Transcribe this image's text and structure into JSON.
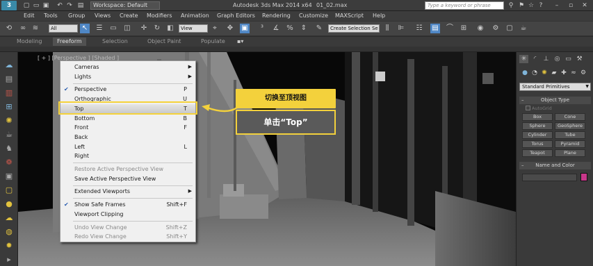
{
  "app": {
    "logo_label": "3",
    "title": "Autodesk 3ds Max  2014 x64",
    "file_name": "01_02.max",
    "workspace": "Workspace: Default",
    "search_placeholder": "Type a keyword or phrase"
  },
  "menubar": {
    "items": [
      "Edit",
      "Tools",
      "Group",
      "Views",
      "Create",
      "Modifiers",
      "Animation",
      "Graph Editors",
      "Rendering",
      "Customize",
      "MAXScript",
      "Help"
    ]
  },
  "toolbar": {
    "selection_filter": "All",
    "reference_coord": "View",
    "named_selection": "Create Selection Se"
  },
  "ribbon": {
    "tabs": [
      "Modeling",
      "Freeform",
      "Selection",
      "Object Paint",
      "Populate"
    ],
    "active_tab": "Freeform"
  },
  "viewport": {
    "label": "[ + ] [Perspective ] [Shaded ]"
  },
  "context_menu": {
    "items": [
      {
        "label": "Cameras",
        "submenu": true
      },
      {
        "label": "Lights",
        "submenu": true
      },
      {
        "label": "Perspective",
        "shortcut": "P",
        "checked": true
      },
      {
        "label": "Orthographic",
        "shortcut": "U"
      },
      {
        "label": "Top",
        "shortcut": "T",
        "highlighted": true
      },
      {
        "label": "Bottom",
        "shortcut": "B"
      },
      {
        "label": "Front",
        "shortcut": "F"
      },
      {
        "label": "Back",
        "shortcut": ""
      },
      {
        "label": "Left",
        "shortcut": "L"
      },
      {
        "label": "Right",
        "shortcut": ""
      },
      {
        "label": "Restore Active Perspective View",
        "disabled": true
      },
      {
        "label": "Save Active Perspective View"
      },
      {
        "label": "Extended Viewports",
        "submenu": true
      },
      {
        "label": "Show Safe Frames",
        "shortcut": "Shift+F",
        "checked": true
      },
      {
        "label": "Viewport Clipping"
      },
      {
        "label": "Undo View Change",
        "shortcut": "Shift+Z",
        "disabled": true
      },
      {
        "label": "Redo View Change",
        "shortcut": "Shift+Y",
        "disabled": true
      }
    ]
  },
  "callout": {
    "heading": "切换至顶视图",
    "instruction": "单击“Top”"
  },
  "command_panel": {
    "dropdown": "Standard Primitives",
    "object_type_title": "Object Type",
    "autogrid_label": "AutoGrid",
    "object_buttons": [
      "Box",
      "Cone",
      "Sphere",
      "GeoSphere",
      "Cylinder",
      "Tube",
      "Torus",
      "Pyramid",
      "Teapot",
      "Plane"
    ],
    "name_color_title": "Name and Color",
    "color": "#c7378a"
  },
  "colors": {
    "highlight": "#f5d23a",
    "callout_body": "#5a5a5a",
    "active_tool": "#4f87c5"
  }
}
